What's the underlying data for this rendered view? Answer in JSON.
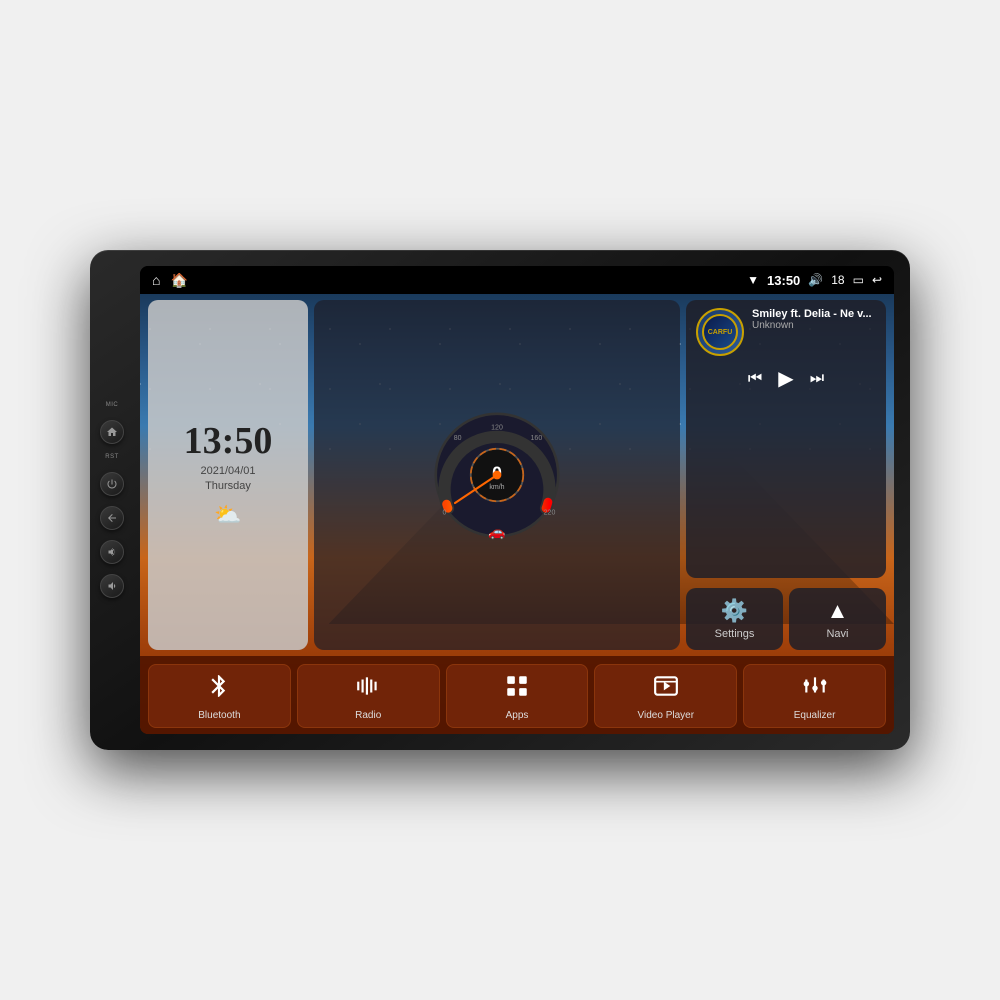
{
  "device": {
    "side_labels": [
      "MIC",
      "RST"
    ],
    "side_buttons": [
      "home",
      "power",
      "back",
      "vol_up",
      "vol_down"
    ]
  },
  "status_bar": {
    "left_icons": [
      "home",
      "house"
    ],
    "time": "13:50",
    "volume_label": "18",
    "right_icons": [
      "wifi",
      "volume",
      "battery",
      "back"
    ]
  },
  "clock": {
    "time": "13:50",
    "date": "2021/04/01",
    "day": "Thursday"
  },
  "music": {
    "title": "Smiley ft. Delia - Ne v...",
    "artist": "Unknown",
    "logo_text": "CARFU"
  },
  "speedometer": {
    "speed": "0",
    "unit": "km/h",
    "max": 220
  },
  "quick_buttons": [
    {
      "id": "settings",
      "label": "Settings",
      "icon": "⚙"
    },
    {
      "id": "navi",
      "label": "Navi",
      "icon": "▲"
    }
  ],
  "app_bar": [
    {
      "id": "bluetooth",
      "label": "Bluetooth"
    },
    {
      "id": "radio",
      "label": "Radio"
    },
    {
      "id": "apps",
      "label": "Apps"
    },
    {
      "id": "video-player",
      "label": "Video Player"
    },
    {
      "id": "equalizer",
      "label": "Equalizer"
    }
  ],
  "colors": {
    "accent_orange": "#c8651a",
    "app_bar_bg": "rgba(80,20,0,0.9)",
    "widget_bg": "rgba(30,30,40,0.85)",
    "gold": "#c8a000"
  }
}
